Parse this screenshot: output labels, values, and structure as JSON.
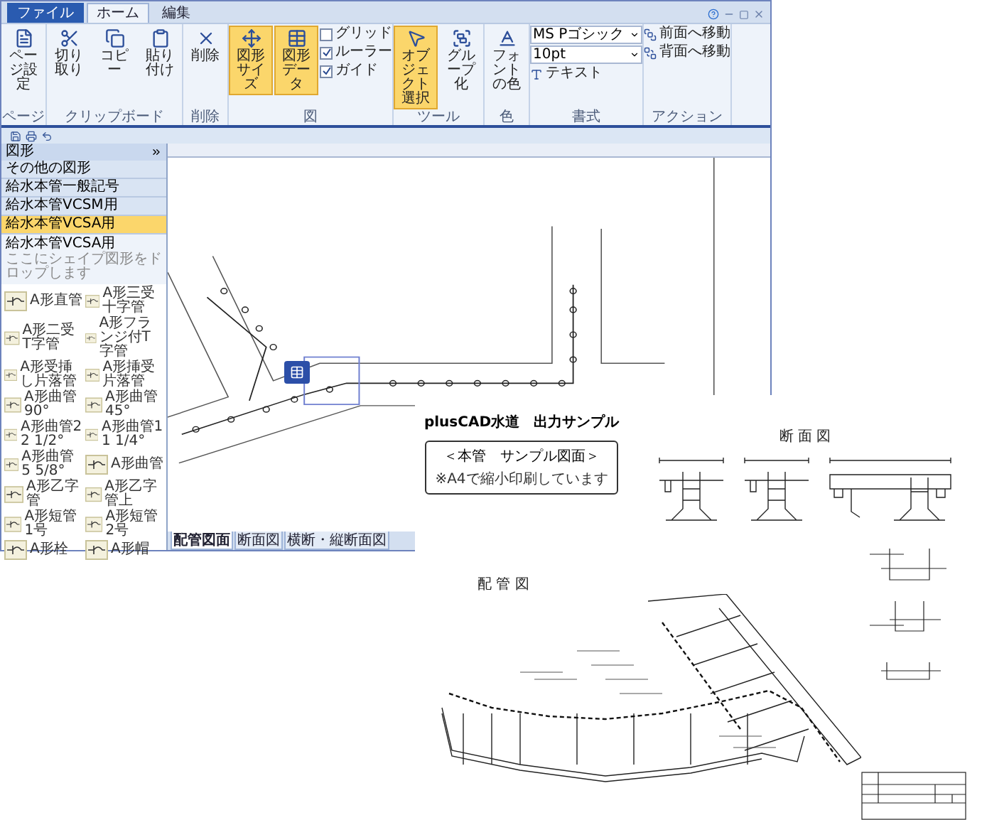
{
  "tabs": [
    {
      "label": "ファイル",
      "kind": "file",
      "selected": false
    },
    {
      "label": "ホーム",
      "kind": "tab",
      "selected": true
    },
    {
      "label": "編集",
      "kind": "tab",
      "selected": false
    }
  ],
  "ribbon": [
    {
      "label": "ページ",
      "items": [
        {
          "kind": "large",
          "label": "ページ設定",
          "active": false
        }
      ]
    },
    {
      "label": "クリップボード",
      "items": [
        {
          "kind": "large",
          "label": "切り取り",
          "active": false
        },
        {
          "kind": "large",
          "label": "コピー",
          "active": false
        },
        {
          "kind": "large",
          "label": "貼り付け",
          "active": false
        }
      ]
    },
    {
      "label": "削除",
      "items": [
        {
          "kind": "large",
          "label": "削除",
          "active": false
        }
      ]
    },
    {
      "label": "図",
      "items": [
        {
          "kind": "large",
          "label": "図形サイズ",
          "active": true
        },
        {
          "kind": "large",
          "label": "図形データ",
          "active": true
        },
        {
          "kind": "check",
          "label": "グリッド",
          "checked": false
        },
        {
          "kind": "check",
          "label": "ルーラー",
          "checked": true
        },
        {
          "kind": "check",
          "label": "ガイド",
          "checked": true
        }
      ]
    },
    {
      "label": "ツール",
      "items": [
        {
          "kind": "large",
          "label": "オブジェクト選択",
          "active": true
        },
        {
          "kind": "large",
          "label": "グループ化",
          "active": false
        }
      ]
    },
    {
      "label": "色",
      "items": [
        {
          "kind": "large",
          "label": "フォントの色",
          "active": false
        }
      ]
    },
    {
      "label": "書式",
      "items": [
        {
          "kind": "field",
          "label": "MS Pゴシック"
        },
        {
          "kind": "field",
          "label": "10pt"
        },
        {
          "kind": "small",
          "label": "テキスト"
        }
      ]
    },
    {
      "label": "アクション",
      "items": [
        {
          "kind": "small",
          "label": "前面へ移動"
        },
        {
          "kind": "small",
          "label": "背面へ移動"
        }
      ]
    }
  ],
  "shapes_panel": {
    "title": "図形",
    "stencils": [
      {
        "label": "その他の図形",
        "selected": false
      },
      {
        "label": "給水本管一般記号",
        "selected": false
      },
      {
        "label": "給水本管VCSM用",
        "selected": false
      },
      {
        "label": "給水本管VCSA用",
        "selected": true
      }
    ],
    "stencil_title": "給水本管VCSA用",
    "hint": "ここにシェイプ図形をドロップします",
    "shapes": [
      "A形直管",
      "A形三受十字管",
      "A形二受T字管",
      "A形フランジ付T字管",
      "A形受挿し片落管",
      "A形挿受片落管",
      "A形曲管90°",
      "A形曲管45°",
      "A形曲管22 1/2°",
      "A形曲管11 1/4°",
      "A形曲管5 5/8°",
      "A形曲管",
      "A形乙字管",
      "A形乙字管上",
      "A形短管1号",
      "A形短管2号",
      "A形栓",
      "A形帽"
    ]
  },
  "sheet_tabs": [
    {
      "label": "配管図面",
      "selected": true
    },
    {
      "label": "断面図",
      "selected": false
    },
    {
      "label": "横断・縦断面図",
      "selected": false
    }
  ],
  "output_sample": {
    "title": "plusCAD水道　出力サンプル",
    "box_title": "＜本管　サンプル図面＞",
    "box_note": "※A4で縮小印刷しています",
    "section_label": "断 面 図",
    "plan_label": "配 管 図"
  }
}
